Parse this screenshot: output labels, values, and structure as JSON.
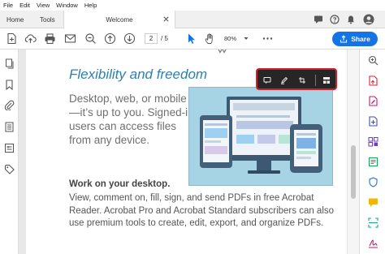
{
  "menu": [
    "File",
    "Edit",
    "View",
    "Window",
    "Help"
  ],
  "tabs": {
    "home": "Home",
    "tools": "Tools",
    "document": "Welcome"
  },
  "toolbar": {
    "page_current": "2",
    "page_total": "/ 5",
    "zoom": "80%",
    "share_label": "Share"
  },
  "document": {
    "heading": "Flexibility and freedom",
    "intro": "Desktop, web, or mobile—it’s up to you. Signed-in users can access files from any device.",
    "subheading": "Work on your desktop.",
    "body": "View, comment on, fill, sign, and send PDFs in free Acrobat Reader. Acrobat Pro and Acrobat Standard subscribers can also use premium tools to create, edit, export, and organize PDFs."
  },
  "colors": {
    "accent": "#1473e6",
    "heading_blue": "#2e7fae",
    "highlight_red": "#d0202a"
  },
  "icons": {
    "tabbar": [
      "chat-icon",
      "help-icon",
      "bell-icon",
      "avatar"
    ],
    "toolbar": [
      "new-file-icon",
      "upload-icon",
      "print-icon",
      "email-icon",
      "zoom-out-icon",
      "page-up-icon",
      "page-down-icon",
      "cursor-icon",
      "hand-icon",
      "more-icon"
    ],
    "left_rail": [
      "pages-icon",
      "bookmark-icon",
      "attachment-icon",
      "document-icon",
      "form-icon",
      "tag-icon"
    ],
    "right_rail": [
      "search-zoom-icon",
      "export-pdf-icon",
      "edit-pdf-icon",
      "create-pdf-icon",
      "organize-pages-icon",
      "comment-icon",
      "scan-icon",
      "protect-icon",
      "sign-icon"
    ],
    "popup_toolbar": [
      "comment-icon",
      "highlight-pen-icon",
      "crop-icon",
      "layout-icon"
    ]
  }
}
